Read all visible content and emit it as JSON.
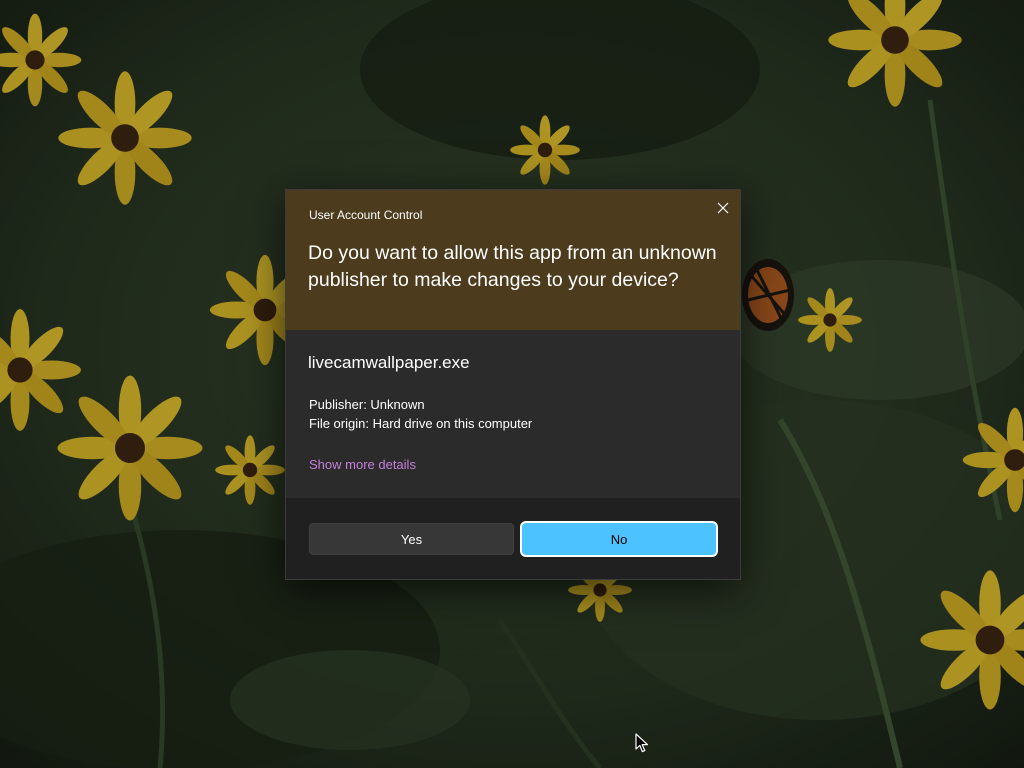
{
  "dialog": {
    "title": "User Account Control",
    "question": "Do you want to allow this app from an unknown publisher to make changes to your device?",
    "app_name": "livecamwallpaper.exe",
    "publisher": "Publisher: Unknown",
    "file_origin": "File origin: Hard drive on this computer",
    "details_link": "Show more details",
    "yes_label": "Yes",
    "no_label": "No",
    "close_icon": "close-icon"
  },
  "colors": {
    "header_background": "#4c3b1c",
    "body_background": "#2b2b2b",
    "footer_background": "#202020",
    "link": "#c67fd9",
    "accent_button": "#4cc2ff",
    "secondary_button": "#373737"
  },
  "wallpaper": {
    "subject": "yellow-flowers-and-butterfly"
  }
}
